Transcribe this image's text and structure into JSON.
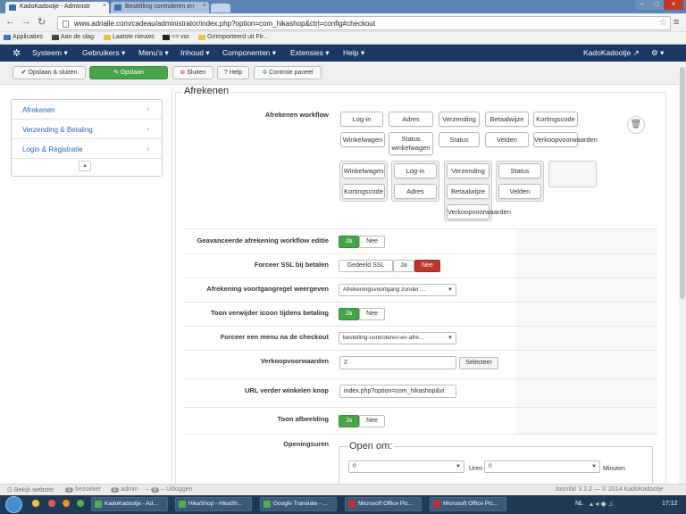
{
  "browser": {
    "tabs": [
      {
        "label": "KadoKadootje - Administr"
      },
      {
        "label": "Bestelling controleren en"
      }
    ],
    "url": "www.adrialle.com/cadeau/administrator/index.php?option=com_hikashop&ctrl=config#checkout",
    "bookmarks": [
      "Applicaties",
      "Aan de slag",
      "Laatste nieuws",
      "<< vor",
      "Geïmporteerd uit Fir..."
    ]
  },
  "joomla_menu": {
    "items": [
      "Systeem",
      "Gebruikers",
      "Menu's",
      "Inhoud",
      "Componenten",
      "Extensies",
      "Help"
    ],
    "site_name": "KadoKadootje"
  },
  "toolbar": {
    "save_close": "Opslaan & sluiten",
    "save": "Opslaan",
    "close": "Sluiten",
    "help": "Help",
    "control_panel": "Controle paneel"
  },
  "sidebar": {
    "items": [
      {
        "label": "Afrekenen"
      },
      {
        "label": "Verzending & Betaling"
      },
      {
        "label": "Login & Registratie"
      }
    ]
  },
  "section": {
    "legend": "Afrekenen"
  },
  "workflow": {
    "label": "Afrekenen workflow",
    "row1": [
      "Log-in",
      "Adres",
      "Verzending",
      "Betaalwijze",
      "Kortingscode"
    ],
    "row2": [
      "Winkelwagen",
      "Status winkelwagen",
      "Status",
      "Velden",
      "Verkoopvoorwaarden"
    ],
    "group1": [
      "Winkelwagen",
      "Kortingscode"
    ],
    "group2": [
      "Log-in",
      "Adres"
    ],
    "group3": [
      "Verzending",
      "Betaalwijze",
      "Verkoopvoorwaarden"
    ],
    "group4": [
      "Status",
      "Velden"
    ]
  },
  "settings": {
    "advanced_workflow": {
      "label": "Geavanceerde afrekening workflow editie",
      "yes": "Ja",
      "no": "Nee"
    },
    "force_ssl": {
      "label": "Forceer SSL bij betalen",
      "partial": "Gedeeld SSL",
      "yes": "Ja",
      "no": "Nee"
    },
    "progress_bar": {
      "label": "Afrekening voortgangregel weergeven",
      "value": "Afrekeningsvoortgang zonder ..."
    },
    "show_delete": {
      "label": "Toon verwijder icoon tijdens betaling",
      "yes": "Ja",
      "no": "Nee"
    },
    "force_menu": {
      "label": "Forceer een menu na de checkout",
      "value": "bestelling-controleren-en-afre..."
    },
    "terms": {
      "label": "Verkoopvoorwaarden",
      "value": "2",
      "button": "Selecteer"
    },
    "continue_url": {
      "label": "URL verder winkelen knop",
      "value": "index.php?option=com_hikashop&vi"
    },
    "show_image": {
      "label": "Toon afbeelding",
      "yes": "Ja",
      "no": "Nee"
    },
    "opening_hours": {
      "label": "Openingsuren",
      "fieldset": "Open om:",
      "hours_value": "0",
      "hours_unit": "Uren",
      "minutes_value": "0",
      "minutes_unit": "Minuten"
    }
  },
  "statusbar": {
    "view_site": "Bekijk website",
    "visitors_count": "1",
    "visitors_label": "bezoeker",
    "admins_count": "1",
    "admins_label": "admin",
    "logout_count": "0",
    "logout_label": "Uitloggen",
    "version": "Joomla! 3.2.2 — © 2014 KadoKadootje"
  },
  "taskbar": {
    "items": [
      "KadoKadootje - Ad...",
      "HikaShop - HikaSh...",
      "Google Translate - ...",
      "Microsoft Office Pic...",
      "Microsoft Office Pic..."
    ],
    "lang": "NL",
    "clock": "17:12"
  }
}
